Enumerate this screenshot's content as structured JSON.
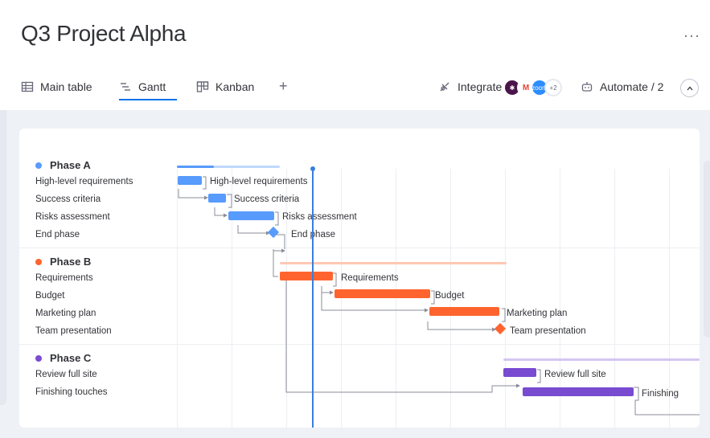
{
  "page": {
    "title": "Q3 Project Alpha",
    "more_label": "···"
  },
  "tabs": [
    {
      "label": "Main table",
      "icon": "table-icon"
    },
    {
      "label": "Gantt",
      "icon": "gantt-icon",
      "active": true
    },
    {
      "label": "Kanban",
      "icon": "kanban-icon"
    },
    {
      "label": "+",
      "icon": "add-icon"
    }
  ],
  "integrate": {
    "label": "Integrate",
    "extra_count": "+2",
    "apps": [
      "slack",
      "gmail",
      "zoom"
    ]
  },
  "automate": {
    "label": "Automate / 2"
  },
  "groups": [
    {
      "name": "Phase A",
      "color": "#579bfc",
      "items": [
        {
          "label": "High-level requirements",
          "bar_label": "High-level requirements"
        },
        {
          "label": "Success criteria",
          "bar_label": "Success criteria"
        },
        {
          "label": "Risks assessment",
          "bar_label": "Risks assessment"
        },
        {
          "label": "End phase",
          "bar_label": "End phase",
          "milestone": true
        }
      ]
    },
    {
      "name": "Phase B",
      "color": "#ff642e",
      "items": [
        {
          "label": "Requirements",
          "bar_label": "Requirements"
        },
        {
          "label": "Budget",
          "bar_label": "Budget"
        },
        {
          "label": "Marketing plan",
          "bar_label": "Marketing plan"
        },
        {
          "label": "Team presentation",
          "bar_label": "Team presentation",
          "milestone": true
        }
      ]
    },
    {
      "name": "Phase C",
      "color": "#784bd1",
      "items": [
        {
          "label": "Review full site",
          "bar_label": "Review full site"
        },
        {
          "label": "Finishing touches",
          "bar_label": "Finishing"
        }
      ]
    }
  ]
}
